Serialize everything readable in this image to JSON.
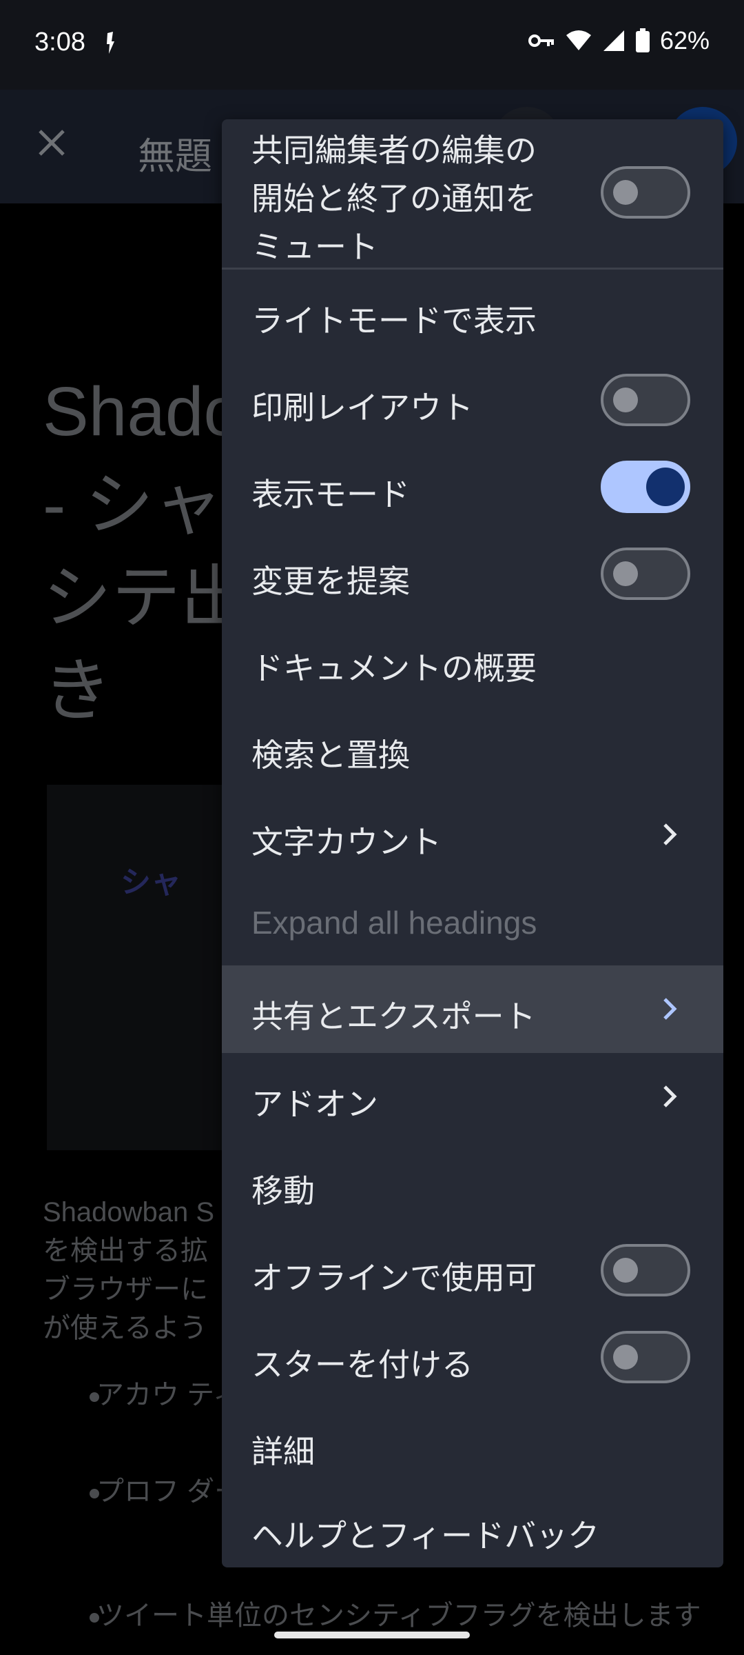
{
  "status_bar": {
    "time": "3:08",
    "battery": "62%",
    "icons": [
      "notification-icon",
      "vpn-key-icon",
      "wifi-icon",
      "signal-icon",
      "battery-icon"
    ]
  },
  "app_bar": {
    "title": "無題",
    "close_icon": "close-icon"
  },
  "document": {
    "heading": "Shadowban - シャンシテ出でき",
    "image_text": "シャ",
    "paragraph": "Shadowban S を検出する拡 ブラウザーに が使えるよう",
    "bullets": [
      "アカウ ティブ",
      "プロフ ダー画 します",
      "ツイート単位のセンシティブフラグを検出します"
    ]
  },
  "menu": {
    "items": [
      {
        "label": "共同編集者の編集の\n開始と終了の通知を\nミュート",
        "control": "toggle",
        "on": false
      },
      {
        "label": "ライトモードで表示",
        "control": "none"
      },
      {
        "label": "印刷レイアウト",
        "control": "toggle",
        "on": false
      },
      {
        "label": "表示モード",
        "control": "toggle",
        "on": true
      },
      {
        "label": "変更を提案",
        "control": "toggle",
        "on": false
      },
      {
        "label": "ドキュメントの概要",
        "control": "none"
      },
      {
        "label": "検索と置換",
        "control": "none"
      },
      {
        "label": "文字カウント",
        "control": "submenu"
      },
      {
        "label": "Expand all headings",
        "control": "none",
        "disabled": true
      },
      {
        "label": "共有とエクスポート",
        "control": "submenu",
        "highlighted": true
      },
      {
        "label": "アドオン",
        "control": "submenu"
      },
      {
        "label": "移動",
        "control": "none"
      },
      {
        "label": "オフラインで使用可",
        "control": "toggle",
        "on": false
      },
      {
        "label": "スターを付ける",
        "control": "toggle",
        "on": false
      },
      {
        "label": "詳細",
        "control": "none"
      },
      {
        "label": "ヘルプとフィードバック",
        "control": "none"
      }
    ]
  },
  "colors": {
    "menu_bg": "#262a35",
    "highlight_bg": "#3e424c",
    "toggle_on_track": "#aec6ff",
    "toggle_on_knob": "#12306e",
    "accent_chevron": "#aec6ff"
  }
}
